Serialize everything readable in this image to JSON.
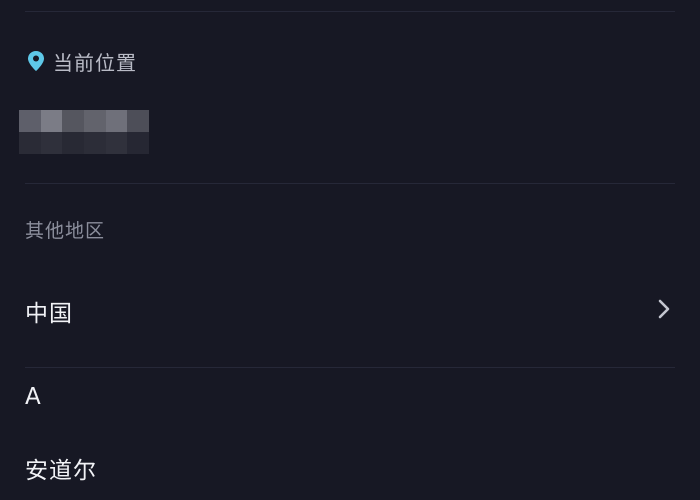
{
  "current_location": {
    "icon": "location-pin-icon",
    "icon_color": "#5ec8e8",
    "label": "当前位置",
    "value_obscured": true
  },
  "other_regions": {
    "label": "其他地区",
    "items": [
      {
        "name": "中国",
        "has_chevron": true
      }
    ]
  },
  "index": {
    "letter": "A",
    "items": [
      "安道尔"
    ]
  },
  "colors": {
    "background": "#171824",
    "divider": "#262838",
    "primary_text": "#f1f2f6",
    "secondary_text": "#8b8e9c"
  }
}
